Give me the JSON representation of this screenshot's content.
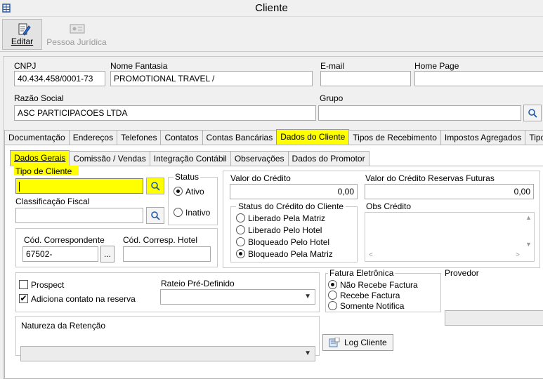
{
  "window": {
    "title": "Cliente"
  },
  "toolbar": {
    "edit_label": "Editar",
    "pj_label": "Pessoa Jurídica"
  },
  "header": {
    "cnpj_label": "CNPJ",
    "cnpj_value": "40.434.458/0001-73",
    "fantasia_label": "Nome Fantasia",
    "fantasia_value": "PROMOTIONAL TRAVEL /",
    "email_label": "E-mail",
    "email_value": "",
    "home_label": "Home Page",
    "home_value": "",
    "razao_label": "Razão Social",
    "razao_value": "ASC PARTICIPACOES LTDA",
    "grupo_label": "Grupo",
    "grupo_value": ""
  },
  "tabs": [
    "Documentação",
    "Endereços",
    "Telefones",
    "Contatos",
    "Contas Bancárias",
    "Dados do Cliente",
    "Tipos de Recebimento",
    "Impostos Agregados",
    "Tipos de"
  ],
  "selected_tab": "Dados do Cliente",
  "subtabs": [
    "Dados Gerais",
    "Comissão / Vendas",
    "Integração Contábil",
    "Observações",
    "Dados do Promotor"
  ],
  "gerais": {
    "tipo_label": "Tipo de Cliente",
    "tipo_value": "",
    "classif_label": "Classificação Fiscal",
    "classif_value": "",
    "status_title": "Status",
    "ativo": "Ativo",
    "inativo": "Inativo",
    "cod_corr_label": "Cód. Correspondente",
    "cod_corr_value": "67502-",
    "ellipsis": "...",
    "cod_hotel_label": "Cód. Corresp. Hotel",
    "cod_hotel_value": ""
  },
  "credito": {
    "valor_label": "Valor do Crédito",
    "valor_value": "0,00",
    "reservas_label": "Valor do Crédito Reservas Futuras",
    "reservas_value": "0,00",
    "status_title": "Status do Crédito do Cliente",
    "options": [
      "Liberado Pela Matriz",
      "Liberado Pelo Hotel",
      "Bloqueado Pelo Hotel",
      "Bloqueado Pela Matriz"
    ],
    "selected": "Bloqueado Pela Matriz",
    "obs_label": "Obs Crédito"
  },
  "misc": {
    "prospect_label": "Prospect",
    "prospect_checked": false,
    "adiciona_label": "Adiciona contato na reserva",
    "adiciona_checked": true,
    "rateio_label": "Rateio Pré-Definido",
    "rateio_value": "",
    "natureza_label": "Natureza da Retenção",
    "natureza_value": ""
  },
  "fatura": {
    "title": "Fatura Eletrônica",
    "options": [
      "Não Recebe Factura",
      "Recebe Factura",
      "Somente Notifica"
    ],
    "selected": "Não Recebe Factura",
    "provedor_label": "Provedor"
  },
  "log_button": "Log Cliente",
  "colors": {
    "highlight": "#ffff00"
  }
}
